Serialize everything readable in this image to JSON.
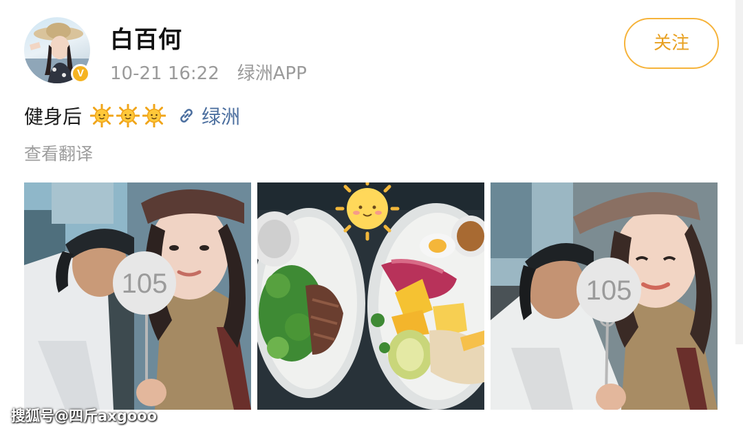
{
  "post": {
    "username": "白百何",
    "timestamp": "10-21 16:22",
    "source": "绿洲APP",
    "follow_label": "关注",
    "verified_badge": "V",
    "text": "健身后",
    "emoji_icons": [
      "sun-icon",
      "sun-icon",
      "sun-icon"
    ],
    "topic_link_label": "绿洲",
    "translate_label": "查看翻译"
  },
  "photos": [
    {
      "name": "selfie-photo-1",
      "sign_number": "105"
    },
    {
      "name": "food-photo",
      "sign_number": ""
    },
    {
      "name": "selfie-photo-2",
      "sign_number": "105"
    }
  ],
  "watermark": "搜狐号@四斤axgooo",
  "colors": {
    "accent": "#f6b33a",
    "link": "#4c6f9f",
    "meta_text": "#9a9a9a",
    "verified": "#f5b321"
  }
}
